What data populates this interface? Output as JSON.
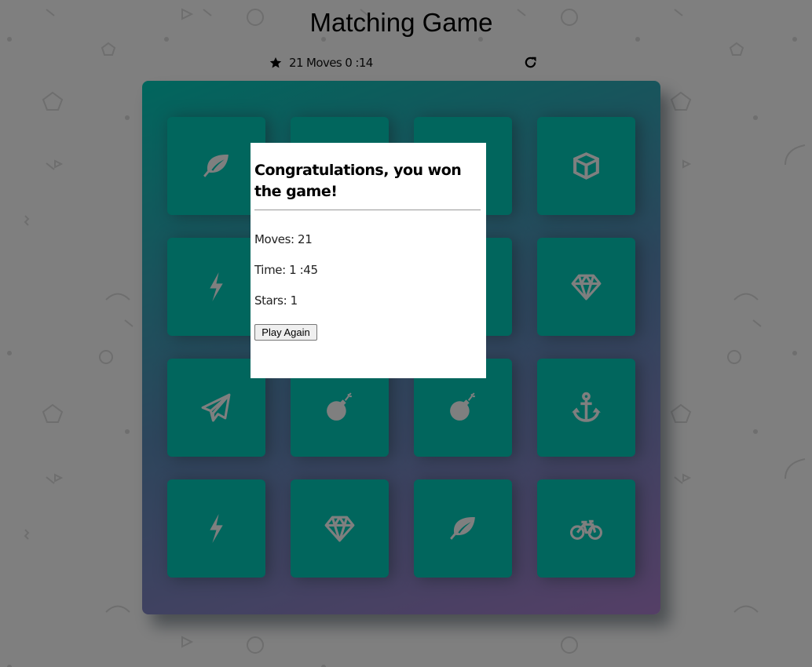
{
  "game": {
    "title": "Matching Game",
    "score_panel": {
      "stars": 1,
      "status_text": "21 Moves 0 :14",
      "restart_icon": "restart-icon"
    },
    "colors": {
      "card_back": "#02ccba",
      "deck_gradient_start": "#02ccba",
      "deck_gradient_end": "#aa7ecd",
      "icon": "#ffffff"
    },
    "cards": [
      {
        "icon": "leaf",
        "state": "open"
      },
      {
        "icon": "unknown",
        "state": "hidden-by-modal"
      },
      {
        "icon": "unknown",
        "state": "hidden-by-modal"
      },
      {
        "icon": "cube",
        "state": "open"
      },
      {
        "icon": "bolt",
        "state": "open"
      },
      {
        "icon": "unknown",
        "state": "hidden-by-modal"
      },
      {
        "icon": "unknown",
        "state": "hidden-by-modal"
      },
      {
        "icon": "diamond",
        "state": "open"
      },
      {
        "icon": "paper-plane",
        "state": "open"
      },
      {
        "icon": "bomb",
        "state": "open"
      },
      {
        "icon": "bomb",
        "state": "open"
      },
      {
        "icon": "anchor",
        "state": "open"
      },
      {
        "icon": "bolt",
        "state": "open"
      },
      {
        "icon": "diamond",
        "state": "open"
      },
      {
        "icon": "leaf",
        "state": "open"
      },
      {
        "icon": "bicycle",
        "state": "open"
      }
    ]
  },
  "modal": {
    "heading": "Congratulations, you won the game!",
    "moves": "Moves: 21",
    "time": "Time: 1 :45",
    "stars": "Stars: 1",
    "play_again_label": "Play Again"
  }
}
